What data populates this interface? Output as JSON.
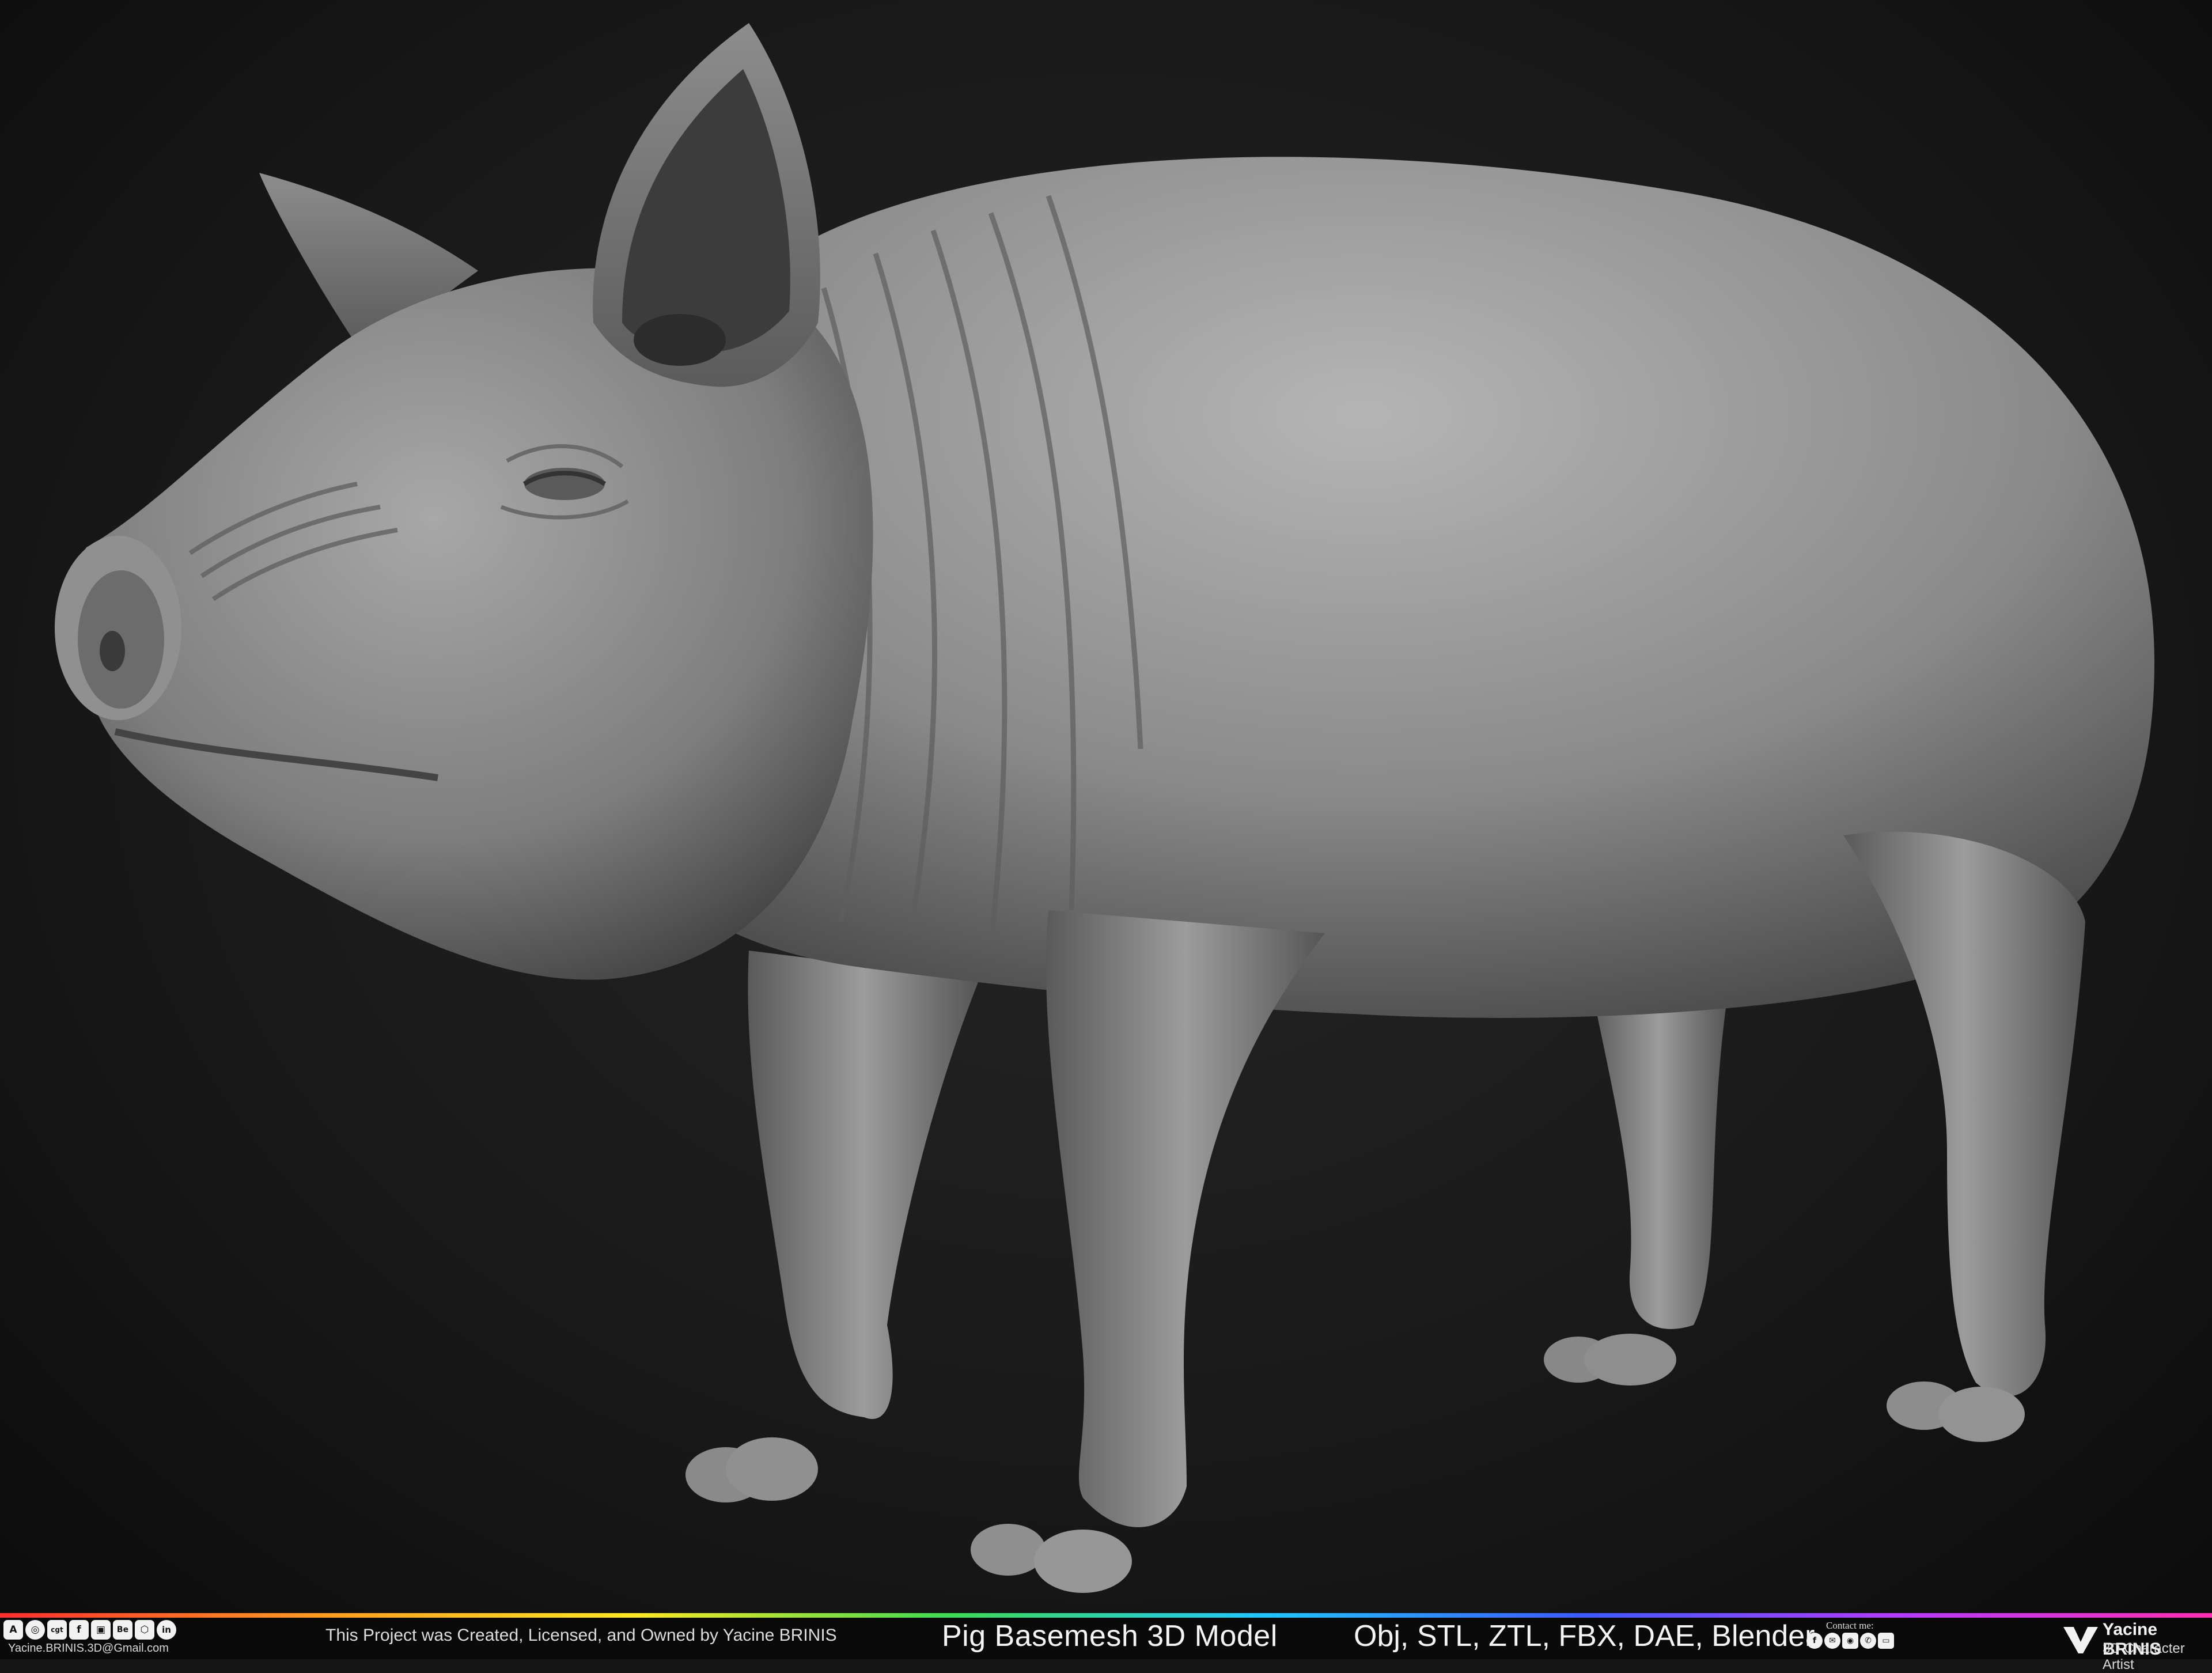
{
  "footer": {
    "social_icons": [
      "artstation-icon",
      "cgtrader-icon",
      "cults3d-icon",
      "facebook-icon",
      "renderhub-icon",
      "behance-icon",
      "turbosquid-icon",
      "linkedin-icon"
    ],
    "social_glyphs": [
      "A",
      "◎",
      "cgt",
      "f",
      "▣",
      "Be",
      "⬡",
      "in"
    ],
    "email": "Yacine.BRINIS.3D@Gmail.com",
    "credit": "This Project was Created, Licensed, and Owned by Yacine BRINIS",
    "title": "Pig Basemesh 3D Model",
    "formats": "Obj, STL, ZTL, FBX, DAE, Blender",
    "contact_label": "Contact me:",
    "contact_icons": [
      "facebook-icon",
      "messenger-icon",
      "instagram-icon",
      "whatsapp-icon",
      "email-icon"
    ],
    "contact_glyphs": [
      "f",
      "✉",
      "◉",
      "✆",
      "▭"
    ],
    "brand_name": "Yacine BRINIS",
    "brand_subtitle": "3D Character Artist"
  },
  "colors": {
    "background": "#1a1a1a",
    "footer_background": "#0a0a0a",
    "model_gray": "#8c8c8c"
  }
}
